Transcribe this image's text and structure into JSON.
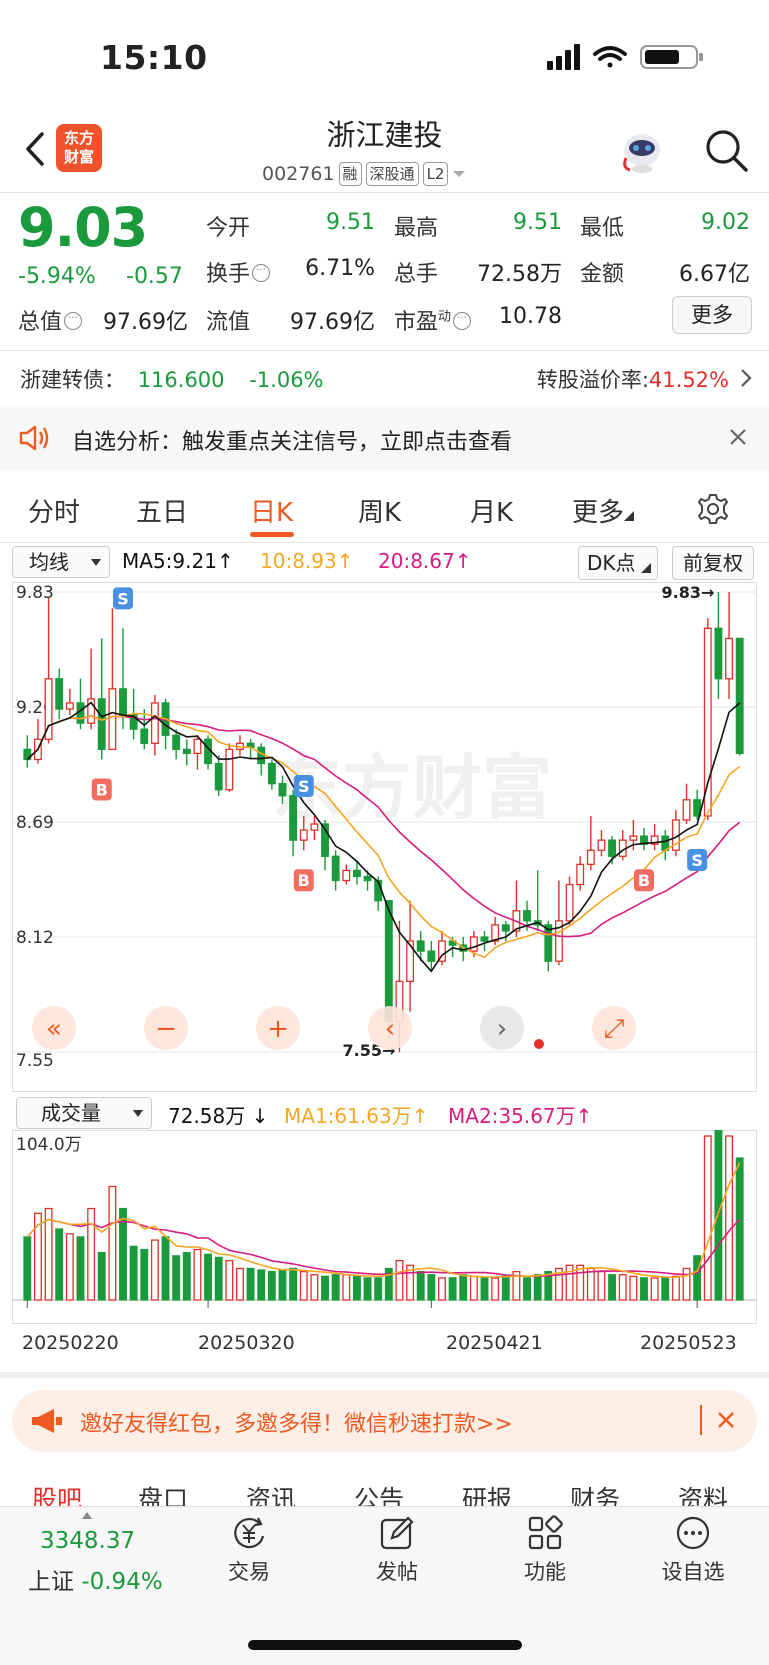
{
  "status": {
    "time": "15:10"
  },
  "header": {
    "logo_line1": "东方",
    "logo_line2": "财富",
    "title": "浙江建投",
    "code": "002761",
    "tags": [
      "融",
      "深股通",
      "L2"
    ]
  },
  "quote": {
    "price": "9.03",
    "change_pct": "-5.94%",
    "change_amt": "-0.57",
    "fields": [
      {
        "label": "今开",
        "value": "9.51",
        "color": "green"
      },
      {
        "label": "最高",
        "value": "9.51",
        "color": "green"
      },
      {
        "label": "最低",
        "value": "9.02",
        "color": "green"
      },
      {
        "label": "换手",
        "value": "6.71%",
        "color": "dark"
      },
      {
        "label": "总手",
        "value": "72.58万",
        "color": "dark"
      },
      {
        "label": "金额",
        "value": "6.67亿",
        "color": "dark"
      },
      {
        "label": "总值",
        "value": "97.69亿",
        "color": "dark"
      },
      {
        "label": "流值",
        "value": "97.69亿",
        "color": "dark"
      },
      {
        "label": "市盈",
        "superscript": "动",
        "value": "10.78",
        "color": "dark"
      }
    ],
    "more_label": "更多"
  },
  "bond": {
    "label": "浙建转债：",
    "price": "116.600",
    "change": "-1.06%",
    "premium_label": "转股溢价率:",
    "premium_value": "41.52%"
  },
  "alert": {
    "text": "自选分析：触发重点关注信号，立即点击查看"
  },
  "tabs": {
    "items": [
      "分时",
      "五日",
      "日K",
      "周K",
      "月K",
      "更多"
    ],
    "active": "日K"
  },
  "ma_bar": {
    "select": "均线",
    "ma5": "MA5:9.21",
    "ma10": "10:8.93",
    "ma20": "20:8.67",
    "dk": "DK点",
    "adjust": "前复权"
  },
  "volume_bar": {
    "select": "成交量",
    "value": "72.58万",
    "ma1": "MA1:61.63万",
    "ma2": "MA2:35.67万"
  },
  "chart_data": {
    "type": "candlestick",
    "y_ticks": [
      "9.83",
      "9.26",
      "8.69",
      "8.12",
      "7.55"
    ],
    "ylim": [
      7.55,
      9.83
    ],
    "high_label": "9.83→",
    "low_label": "←7.55",
    "x_labels": [
      "20250220",
      "20250320",
      "20250421",
      "20250523"
    ],
    "volume_max_label": "104.0万",
    "colors": {
      "up": "#e0302a",
      "down": "#1a9a3c",
      "ma5": "#111111",
      "ma10": "#f5a623",
      "ma20": "#d81b7f"
    },
    "markers": [
      "B",
      "S",
      "B",
      "S",
      "B",
      "S"
    ],
    "candles": [
      [
        9.05,
        9.0,
        9.12,
        8.96
      ],
      [
        9.0,
        9.1,
        9.2,
        8.98
      ],
      [
        9.1,
        9.4,
        9.8,
        9.08
      ],
      [
        9.4,
        9.25,
        9.45,
        9.2
      ],
      [
        9.25,
        9.28,
        9.35,
        9.22
      ],
      [
        9.28,
        9.18,
        9.4,
        9.15
      ],
      [
        9.18,
        9.3,
        9.55,
        9.15
      ],
      [
        9.3,
        9.05,
        9.6,
        9.0
      ],
      [
        9.05,
        9.35,
        9.75,
        9.05
      ],
      [
        9.35,
        9.22,
        9.65,
        9.15
      ],
      [
        9.22,
        9.15,
        9.35,
        9.1
      ],
      [
        9.15,
        9.08,
        9.25,
        9.05
      ],
      [
        9.08,
        9.28,
        9.32,
        9.02
      ],
      [
        9.28,
        9.12,
        9.3,
        9.05
      ],
      [
        9.12,
        9.05,
        9.15,
        9.0
      ],
      [
        9.05,
        9.03,
        9.1,
        8.97
      ],
      [
        9.03,
        9.1,
        9.12,
        8.95
      ],
      [
        9.1,
        8.98,
        9.12,
        8.95
      ],
      [
        8.98,
        8.85,
        9.02,
        8.82
      ],
      [
        8.85,
        9.05,
        9.08,
        8.84
      ],
      [
        9.05,
        9.08,
        9.12,
        9.02
      ],
      [
        9.08,
        9.06,
        9.1,
        9.0
      ],
      [
        9.06,
        8.98,
        9.08,
        8.92
      ],
      [
        8.98,
        8.88,
        9.0,
        8.85
      ],
      [
        8.88,
        8.82,
        8.92,
        8.78
      ],
      [
        8.82,
        8.6,
        8.85,
        8.52
      ],
      [
        8.6,
        8.65,
        8.72,
        8.55
      ],
      [
        8.65,
        8.68,
        8.72,
        8.6
      ],
      [
        8.68,
        8.52,
        8.7,
        8.45
      ],
      [
        8.52,
        8.4,
        8.55,
        8.35
      ],
      [
        8.4,
        8.45,
        8.48,
        8.38
      ],
      [
        8.45,
        8.42,
        8.5,
        8.38
      ],
      [
        8.42,
        8.4,
        8.45,
        8.35
      ],
      [
        8.4,
        8.3,
        8.42,
        8.25
      ],
      [
        8.3,
        7.7,
        8.3,
        7.62
      ],
      [
        7.7,
        7.9,
        8.2,
        7.55
      ],
      [
        7.9,
        8.1,
        8.3,
        7.75
      ],
      [
        8.1,
        8.05,
        8.15,
        8.0
      ],
      [
        8.05,
        8.0,
        8.1,
        7.95
      ],
      [
        8.0,
        8.1,
        8.15,
        7.98
      ],
      [
        8.1,
        8.08,
        8.12,
        8.02
      ],
      [
        8.08,
        8.05,
        8.12,
        8.0
      ],
      [
        8.05,
        8.12,
        8.15,
        8.02
      ],
      [
        8.12,
        8.1,
        8.15,
        8.05
      ],
      [
        8.1,
        8.18,
        8.22,
        8.08
      ],
      [
        8.18,
        8.15,
        8.2,
        8.1
      ],
      [
        8.15,
        8.25,
        8.4,
        8.12
      ],
      [
        8.25,
        8.2,
        8.3,
        8.15
      ],
      [
        8.2,
        8.18,
        8.45,
        8.15
      ],
      [
        8.18,
        8.0,
        8.2,
        7.95
      ],
      [
        8.0,
        8.2,
        8.4,
        7.98
      ],
      [
        8.2,
        8.38,
        8.42,
        8.18
      ],
      [
        8.38,
        8.48,
        8.52,
        8.35
      ],
      [
        8.48,
        8.55,
        8.72,
        8.45
      ],
      [
        8.55,
        8.6,
        8.65,
        8.52
      ],
      [
        8.6,
        8.52,
        8.62,
        8.48
      ],
      [
        8.52,
        8.6,
        8.65,
        8.5
      ],
      [
        8.6,
        8.62,
        8.7,
        8.55
      ],
      [
        8.62,
        8.58,
        8.66,
        8.55
      ],
      [
        8.58,
        8.62,
        8.68,
        8.55
      ],
      [
        8.62,
        8.55,
        8.65,
        8.5
      ],
      [
        8.55,
        8.7,
        8.75,
        8.52
      ],
      [
        8.7,
        8.8,
        8.88,
        8.68
      ],
      [
        8.8,
        8.72,
        8.85,
        8.7
      ],
      [
        8.72,
        9.65,
        9.7,
        8.7
      ],
      [
        9.65,
        9.4,
        9.83,
        9.3
      ],
      [
        9.4,
        9.6,
        9.83,
        9.3
      ],
      [
        9.6,
        9.03,
        9.51,
        9.02
      ]
    ],
    "volumes": [
      40,
      55,
      58,
      45,
      42,
      40,
      58,
      30,
      72,
      58,
      34,
      32,
      38,
      40,
      28,
      30,
      32,
      29,
      27,
      25,
      20,
      20,
      19,
      18,
      19,
      20,
      18,
      16,
      15,
      16,
      16,
      15,
      14,
      14,
      20,
      25,
      22,
      18,
      16,
      14,
      14,
      16,
      15,
      14,
      14,
      15,
      18,
      14,
      16,
      18,
      20,
      22,
      22,
      20,
      18,
      16,
      16,
      15,
      14,
      14,
      14,
      15,
      20,
      28,
      104,
      110,
      104,
      90
    ]
  },
  "invite": {
    "text": "邀好友得红包，多邀多得！微信秒速打款>>"
  },
  "sections": [
    "股吧",
    "盘口",
    "资讯",
    "公告",
    "研报",
    "财务",
    "资料"
  ],
  "bottom_nav": {
    "index_value": "3348.37",
    "index_name": "上证",
    "index_change": "-0.94%",
    "items": [
      "交易",
      "发帖",
      "功能",
      "设自选"
    ]
  }
}
